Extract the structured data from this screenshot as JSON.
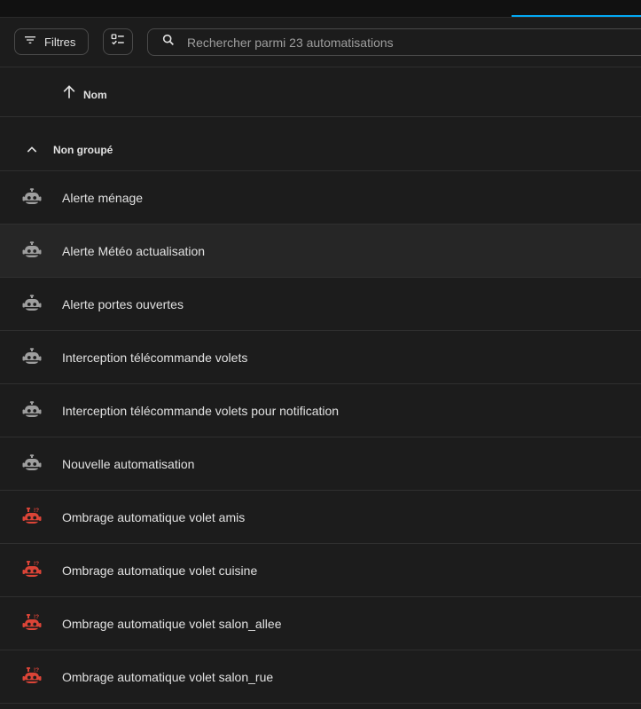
{
  "toolbar": {
    "filters_label": "Filtres",
    "search_placeholder": "Rechercher parmi 23 automatisations"
  },
  "table": {
    "sort_column_label": "Nom",
    "group_label": "Non groupé",
    "rows": [
      {
        "name": "Alerte ménage",
        "status": "normal"
      },
      {
        "name": "Alerte Météo actualisation",
        "status": "normal"
      },
      {
        "name": "Alerte portes ouvertes",
        "status": "normal"
      },
      {
        "name": "Interception télécommande volets",
        "status": "normal"
      },
      {
        "name": "Interception télécommande volets pour notification",
        "status": "normal"
      },
      {
        "name": "Nouvelle automatisation",
        "status": "normal"
      },
      {
        "name": "Ombrage automatique volet amis",
        "status": "error"
      },
      {
        "name": "Ombrage automatique volet cuisine",
        "status": "error"
      },
      {
        "name": "Ombrage automatique volet salon_allee",
        "status": "error"
      },
      {
        "name": "Ombrage automatique volet salon_rue",
        "status": "error"
      }
    ]
  },
  "colors": {
    "background": "#1c1c1c",
    "accent": "#03a9f4",
    "icon_normal": "#9e9e9e",
    "icon_error": "#db4437"
  },
  "icons": {
    "filters": "filter-icon",
    "select": "checklist-icon",
    "search": "search-icon",
    "sort": "arrow-up-icon",
    "group": "chevron-up-icon",
    "row_normal": "robot-icon",
    "row_error": "robot-alert-icon"
  }
}
